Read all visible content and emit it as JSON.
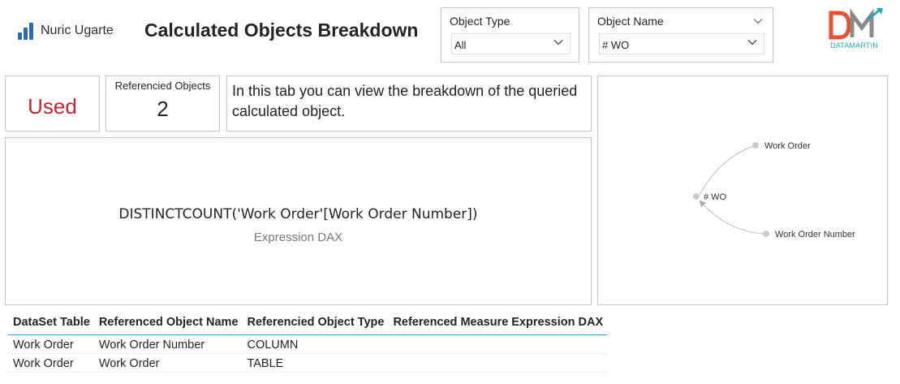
{
  "header": {
    "logo_text": "Nuric Ugarte",
    "title": "Calculated Objects Breakdown",
    "brand_logo_text": "DATAMARTIN",
    "brand_color_orange": "#e8512f",
    "brand_color_teal": "#2aa7c0"
  },
  "filters": {
    "object_type": {
      "label": "Object Type",
      "value": "All",
      "icon": "chevron-down-icon"
    },
    "object_name": {
      "label": "Object Name",
      "value": "# WO",
      "icon": "chevron-down-icon"
    }
  },
  "cards": {
    "status": {
      "value": "Used",
      "color": "#c4262e"
    },
    "referenced_objects": {
      "label": "Referencied Objects",
      "value": "2"
    },
    "info": {
      "text": "In this tab you can view the breakdown of the queried calculated object."
    }
  },
  "expression": {
    "dax": "DISTINCTCOUNT('Work Order'[Work Order Number])",
    "label": "Expression DAX"
  },
  "graph": {
    "center": "# WO",
    "nodes": [
      "Work Order",
      "Work Order Number"
    ]
  },
  "table": {
    "columns": [
      "DataSet Table",
      "Referenced Object Name",
      "Referencied Object Type",
      "Referenced Measure Expression DAX"
    ],
    "rows": [
      [
        "Work Order",
        "Work Order Number",
        "COLUMN",
        ""
      ],
      [
        "Work Order",
        "Work Order",
        "TABLE",
        ""
      ]
    ]
  }
}
